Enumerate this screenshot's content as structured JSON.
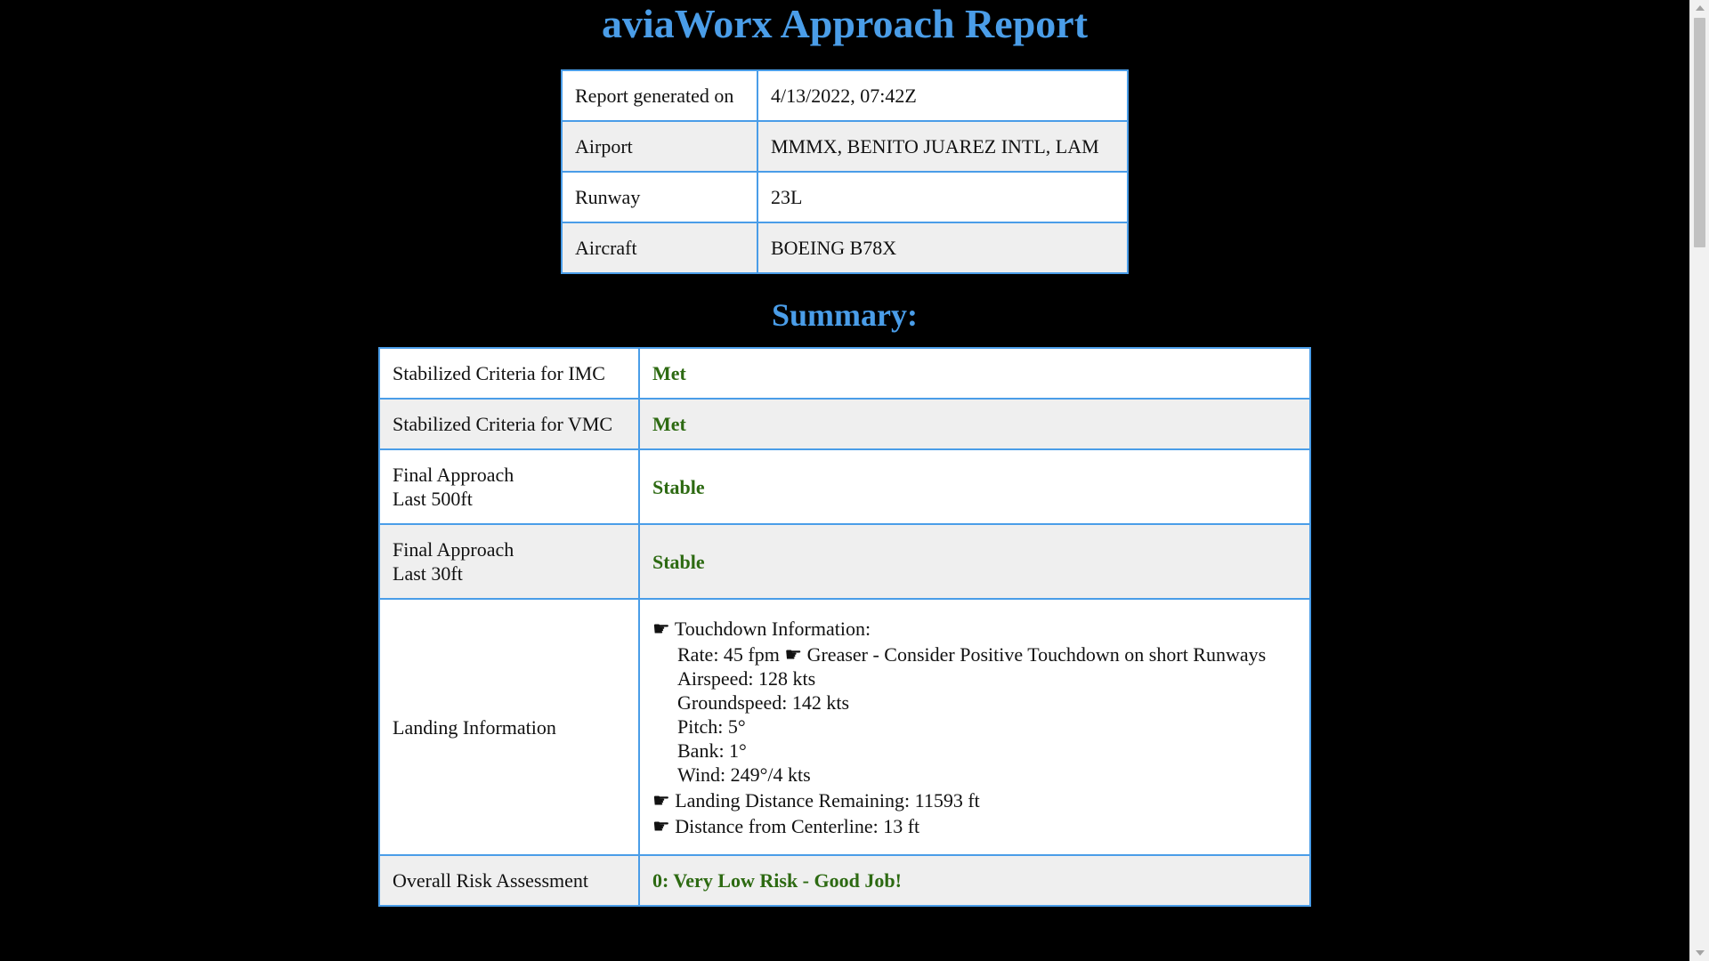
{
  "page": {
    "title": "aviaWorx Approach Report",
    "summary_title": "Summary:"
  },
  "info_rows": [
    {
      "label": "Report generated on",
      "value": "4/13/2022, 07:42Z"
    },
    {
      "label": "Airport",
      "value": "MMMX, BENITO JUAREZ INTL, LAM"
    },
    {
      "label": "Runway",
      "value": "23L"
    },
    {
      "label": "Aircraft",
      "value": "BOEING B78X"
    }
  ],
  "summary": {
    "imc": {
      "label": "Stabilized Criteria for IMC",
      "value": "Met"
    },
    "vmc": {
      "label": "Stabilized Criteria for VMC",
      "value": "Met"
    },
    "final500": {
      "label_line1": "Final Approach",
      "label_line2": "Last 500ft",
      "value": "Stable"
    },
    "final30": {
      "label_line1": "Final Approach",
      "label_line2": "Last 30ft",
      "value": "Stable"
    },
    "landing": {
      "label": "Landing Information",
      "touchdown_header": "☛ Touchdown Information:",
      "rate": "Rate: 45 fpm ☛ Greaser - Consider Positive Touchdown on short Runways",
      "airspeed": "Airspeed: 128 kts",
      "groundspeed": "Groundspeed: 142 kts",
      "pitch": "Pitch: 5°",
      "bank": "Bank: 1°",
      "wind": "Wind: 249°/4 kts",
      "distance_remaining": "☛ Landing Distance Remaining: 11593 ft",
      "centerline": "☛ Distance from Centerline: 13 ft"
    },
    "risk": {
      "label": "Overall Risk Assessment",
      "value": "0: Very Low Risk - Good Job!"
    }
  },
  "colors": {
    "heading": "#4a9de8",
    "border": "#4a9de8",
    "good": "#2d6a12",
    "background": "#000000"
  },
  "scrollbar": {
    "position_fraction": 0.0
  }
}
